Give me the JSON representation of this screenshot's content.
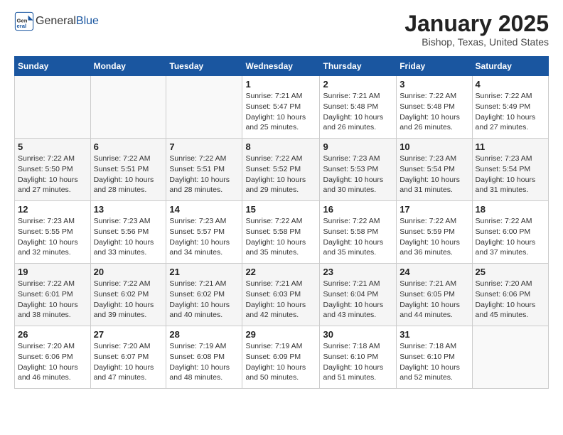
{
  "header": {
    "logo_general": "General",
    "logo_blue": "Blue",
    "month_title": "January 2025",
    "location": "Bishop, Texas, United States"
  },
  "days_of_week": [
    "Sunday",
    "Monday",
    "Tuesday",
    "Wednesday",
    "Thursday",
    "Friday",
    "Saturday"
  ],
  "weeks": [
    [
      {
        "day": "",
        "info": ""
      },
      {
        "day": "",
        "info": ""
      },
      {
        "day": "",
        "info": ""
      },
      {
        "day": "1",
        "info": "Sunrise: 7:21 AM\nSunset: 5:47 PM\nDaylight: 10 hours\nand 25 minutes."
      },
      {
        "day": "2",
        "info": "Sunrise: 7:21 AM\nSunset: 5:48 PM\nDaylight: 10 hours\nand 26 minutes."
      },
      {
        "day": "3",
        "info": "Sunrise: 7:22 AM\nSunset: 5:48 PM\nDaylight: 10 hours\nand 26 minutes."
      },
      {
        "day": "4",
        "info": "Sunrise: 7:22 AM\nSunset: 5:49 PM\nDaylight: 10 hours\nand 27 minutes."
      }
    ],
    [
      {
        "day": "5",
        "info": "Sunrise: 7:22 AM\nSunset: 5:50 PM\nDaylight: 10 hours\nand 27 minutes."
      },
      {
        "day": "6",
        "info": "Sunrise: 7:22 AM\nSunset: 5:51 PM\nDaylight: 10 hours\nand 28 minutes."
      },
      {
        "day": "7",
        "info": "Sunrise: 7:22 AM\nSunset: 5:51 PM\nDaylight: 10 hours\nand 28 minutes."
      },
      {
        "day": "8",
        "info": "Sunrise: 7:22 AM\nSunset: 5:52 PM\nDaylight: 10 hours\nand 29 minutes."
      },
      {
        "day": "9",
        "info": "Sunrise: 7:23 AM\nSunset: 5:53 PM\nDaylight: 10 hours\nand 30 minutes."
      },
      {
        "day": "10",
        "info": "Sunrise: 7:23 AM\nSunset: 5:54 PM\nDaylight: 10 hours\nand 31 minutes."
      },
      {
        "day": "11",
        "info": "Sunrise: 7:23 AM\nSunset: 5:54 PM\nDaylight: 10 hours\nand 31 minutes."
      }
    ],
    [
      {
        "day": "12",
        "info": "Sunrise: 7:23 AM\nSunset: 5:55 PM\nDaylight: 10 hours\nand 32 minutes."
      },
      {
        "day": "13",
        "info": "Sunrise: 7:23 AM\nSunset: 5:56 PM\nDaylight: 10 hours\nand 33 minutes."
      },
      {
        "day": "14",
        "info": "Sunrise: 7:23 AM\nSunset: 5:57 PM\nDaylight: 10 hours\nand 34 minutes."
      },
      {
        "day": "15",
        "info": "Sunrise: 7:22 AM\nSunset: 5:58 PM\nDaylight: 10 hours\nand 35 minutes."
      },
      {
        "day": "16",
        "info": "Sunrise: 7:22 AM\nSunset: 5:58 PM\nDaylight: 10 hours\nand 35 minutes."
      },
      {
        "day": "17",
        "info": "Sunrise: 7:22 AM\nSunset: 5:59 PM\nDaylight: 10 hours\nand 36 minutes."
      },
      {
        "day": "18",
        "info": "Sunrise: 7:22 AM\nSunset: 6:00 PM\nDaylight: 10 hours\nand 37 minutes."
      }
    ],
    [
      {
        "day": "19",
        "info": "Sunrise: 7:22 AM\nSunset: 6:01 PM\nDaylight: 10 hours\nand 38 minutes."
      },
      {
        "day": "20",
        "info": "Sunrise: 7:22 AM\nSunset: 6:02 PM\nDaylight: 10 hours\nand 39 minutes."
      },
      {
        "day": "21",
        "info": "Sunrise: 7:21 AM\nSunset: 6:02 PM\nDaylight: 10 hours\nand 40 minutes."
      },
      {
        "day": "22",
        "info": "Sunrise: 7:21 AM\nSunset: 6:03 PM\nDaylight: 10 hours\nand 42 minutes."
      },
      {
        "day": "23",
        "info": "Sunrise: 7:21 AM\nSunset: 6:04 PM\nDaylight: 10 hours\nand 43 minutes."
      },
      {
        "day": "24",
        "info": "Sunrise: 7:21 AM\nSunset: 6:05 PM\nDaylight: 10 hours\nand 44 minutes."
      },
      {
        "day": "25",
        "info": "Sunrise: 7:20 AM\nSunset: 6:06 PM\nDaylight: 10 hours\nand 45 minutes."
      }
    ],
    [
      {
        "day": "26",
        "info": "Sunrise: 7:20 AM\nSunset: 6:06 PM\nDaylight: 10 hours\nand 46 minutes."
      },
      {
        "day": "27",
        "info": "Sunrise: 7:20 AM\nSunset: 6:07 PM\nDaylight: 10 hours\nand 47 minutes."
      },
      {
        "day": "28",
        "info": "Sunrise: 7:19 AM\nSunset: 6:08 PM\nDaylight: 10 hours\nand 48 minutes."
      },
      {
        "day": "29",
        "info": "Sunrise: 7:19 AM\nSunset: 6:09 PM\nDaylight: 10 hours\nand 50 minutes."
      },
      {
        "day": "30",
        "info": "Sunrise: 7:18 AM\nSunset: 6:10 PM\nDaylight: 10 hours\nand 51 minutes."
      },
      {
        "day": "31",
        "info": "Sunrise: 7:18 AM\nSunset: 6:10 PM\nDaylight: 10 hours\nand 52 minutes."
      },
      {
        "day": "",
        "info": ""
      }
    ]
  ]
}
